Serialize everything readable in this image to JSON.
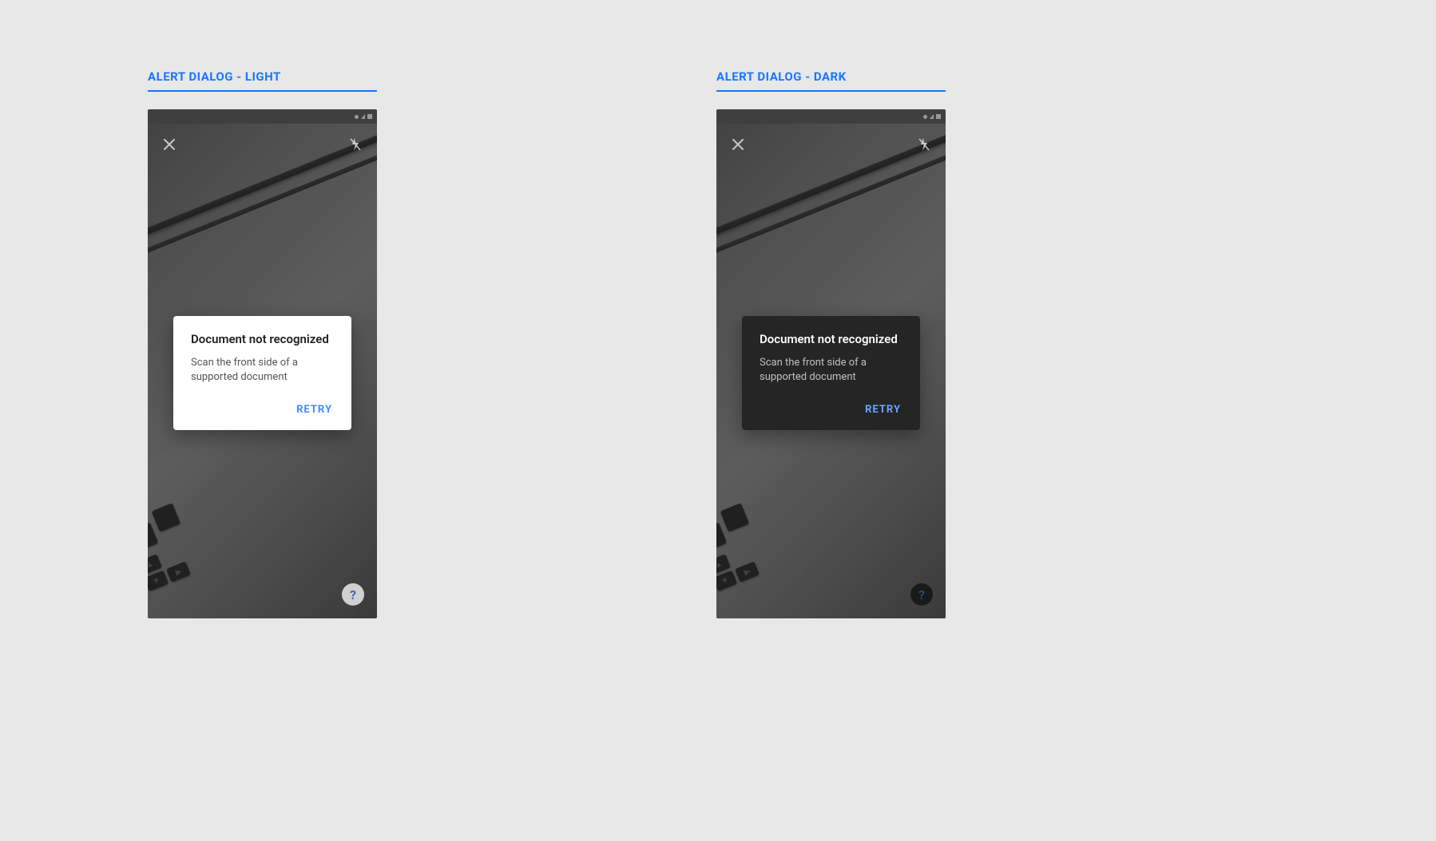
{
  "sections": {
    "light": {
      "header": "ALERT DIALOG - LIGHT",
      "dialog": {
        "title": "Document not recognized",
        "body": "Scan the front side of a supported document",
        "retry_label": "RETRY"
      },
      "help_glyph": "?"
    },
    "dark": {
      "header": "ALERT DIALOG - DARK",
      "dialog": {
        "title": "Document not recognized",
        "body": "Scan the front side of a supported document",
        "retry_label": "RETRY"
      },
      "help_glyph": "?"
    }
  },
  "colors": {
    "accent": "#1976ff",
    "dialog_light_bg": "#ffffff",
    "dialog_dark_bg": "#252525"
  }
}
